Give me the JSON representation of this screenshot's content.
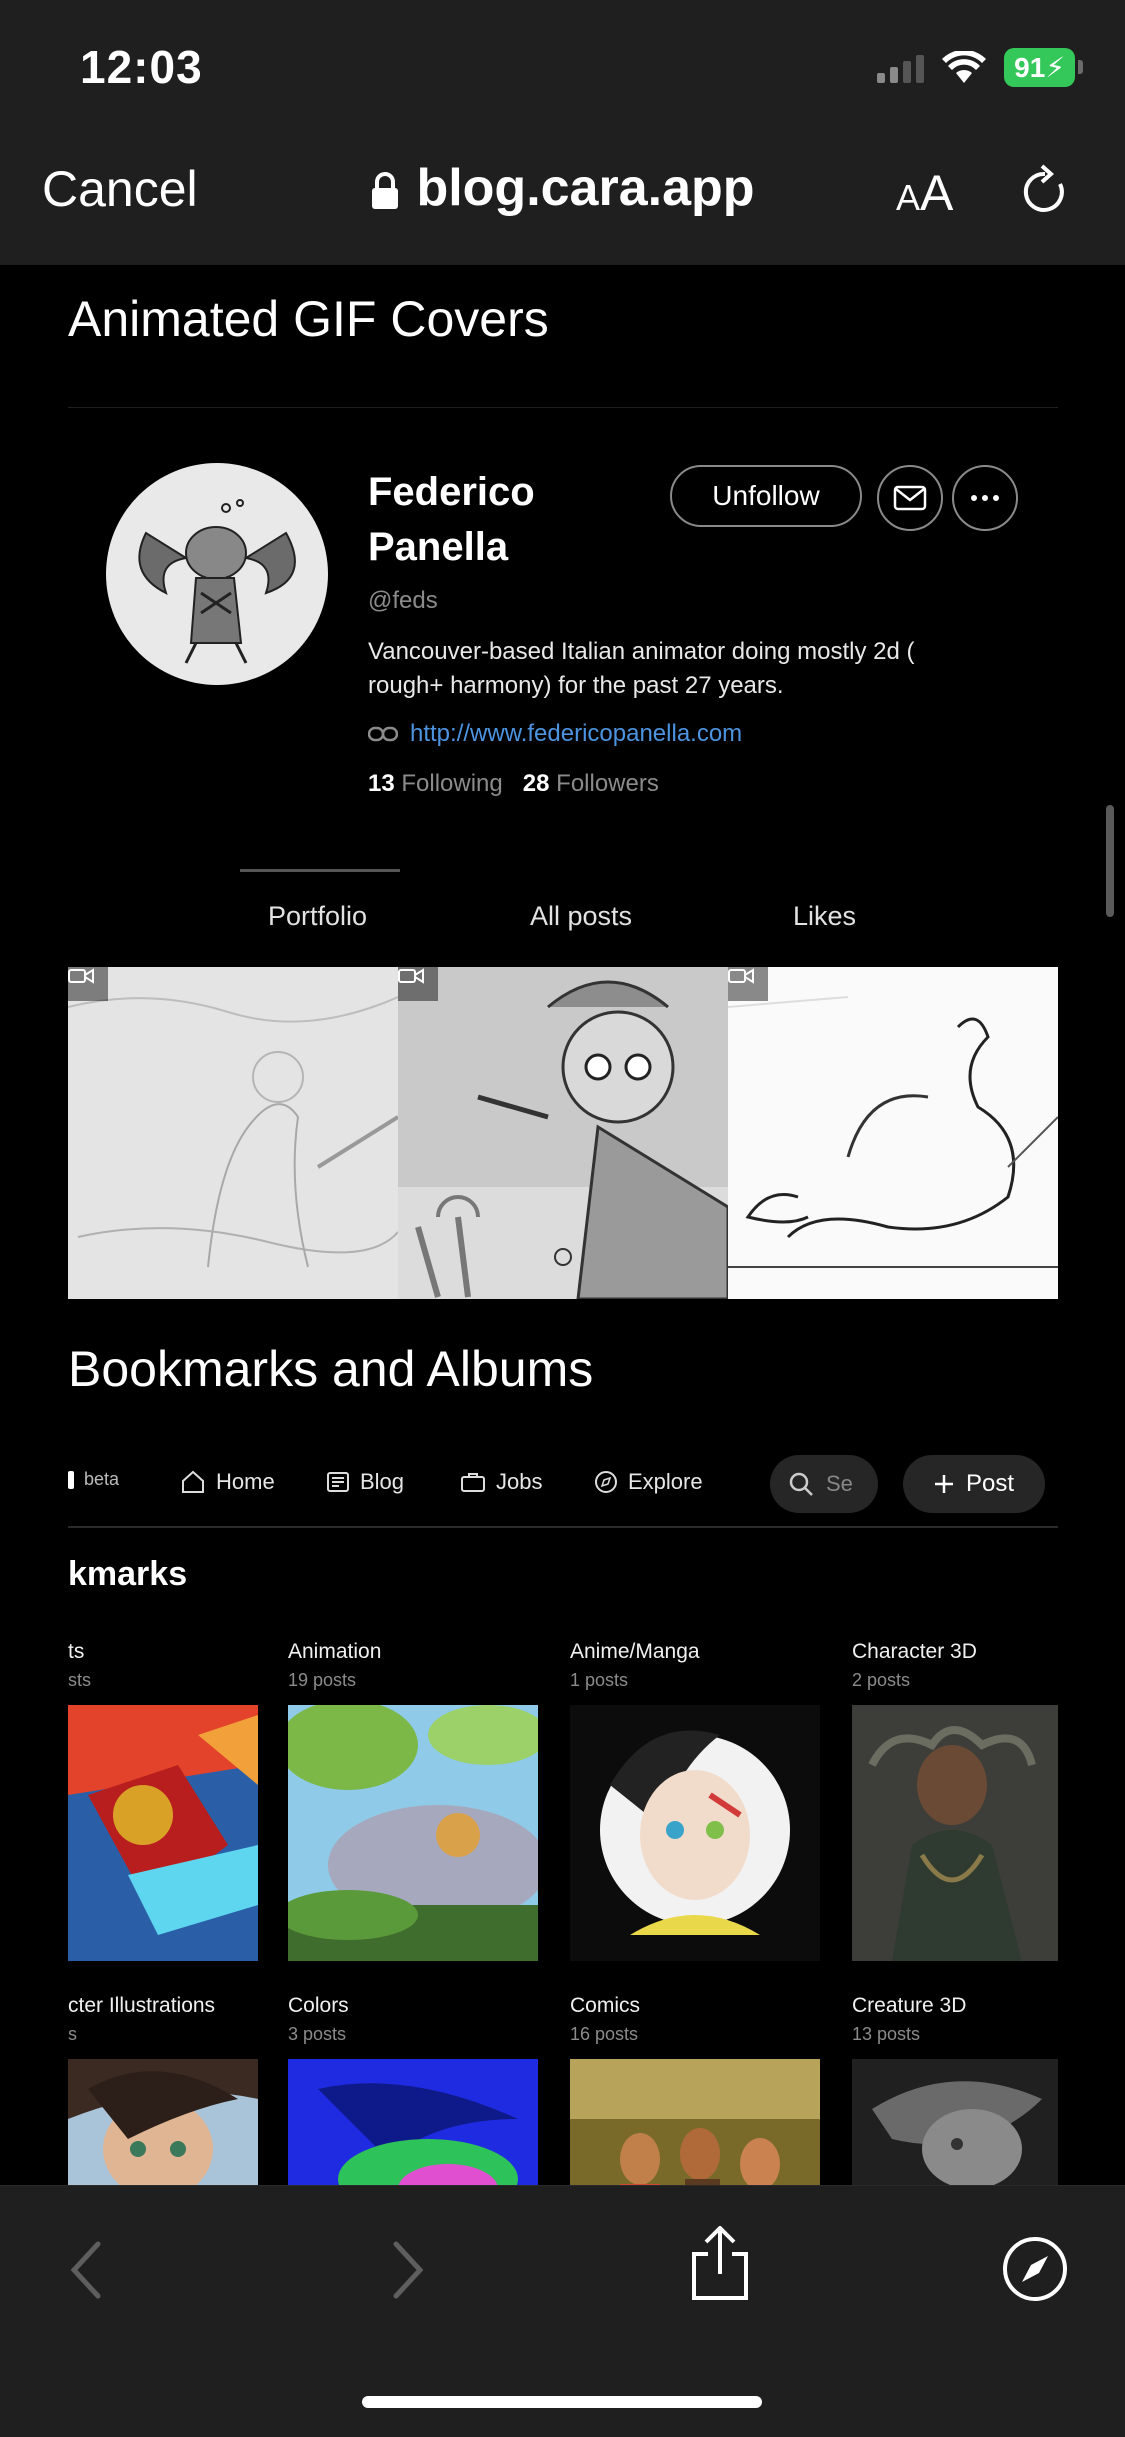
{
  "status": {
    "time": "12:03",
    "battery": "91"
  },
  "browser": {
    "cancel": "Cancel",
    "url": "blog.cara.app",
    "text_size": "AA"
  },
  "section1": {
    "title": "Animated GIF Covers"
  },
  "profile": {
    "name_line1": "Federico",
    "name_line2": "Panella",
    "handle": "@feds",
    "bio": "Vancouver-based Italian animator doing mostly 2d ( rough+ harmony) for the past 27 years.",
    "website": "http://www.federicopanella.com",
    "following_count": "13",
    "following_label": "Following",
    "followers_count": "28",
    "followers_label": "Followers",
    "unfollow": "Unfollow"
  },
  "tabs": [
    "Portfolio",
    "All posts",
    "Likes"
  ],
  "section2": {
    "title": "Bookmarks and Albums"
  },
  "cara_nav": {
    "beta": "beta",
    "items": [
      "Home",
      "Blog",
      "Jobs",
      "Explore"
    ],
    "search_placeholder": "Se",
    "post": "Post"
  },
  "bookmarks_title": "kmarks",
  "albums": [
    {
      "title": "ts",
      "count": "sts"
    },
    {
      "title": "Animation",
      "count": "19 posts"
    },
    {
      "title": "Anime/Manga",
      "count": "1 posts"
    },
    {
      "title": "Character 3D",
      "count": "2 posts"
    },
    {
      "title": "cter Illustrations",
      "count": "s"
    },
    {
      "title": "Colors",
      "count": "3 posts"
    },
    {
      "title": "Comics",
      "count": "16 posts"
    },
    {
      "title": "Creature 3D",
      "count": "13 posts"
    }
  ],
  "colors": {
    "link": "#4d94e0",
    "battery": "#34c759",
    "bar": "#1f1f1f"
  }
}
